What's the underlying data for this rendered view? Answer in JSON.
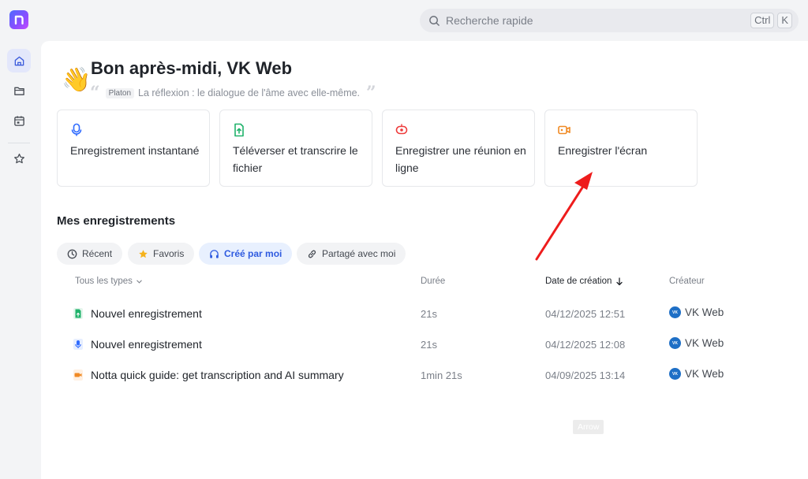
{
  "app": {
    "logo_letter": "n"
  },
  "search": {
    "placeholder": "Recherche rapide",
    "shortcut_keys": [
      "Ctrl",
      "K"
    ]
  },
  "sidebar": {
    "items": [
      {
        "icon": "home-icon",
        "active": true
      },
      {
        "icon": "folder-icon",
        "active": false
      },
      {
        "icon": "calendar-icon",
        "active": false
      },
      {
        "icon": "star-icon",
        "active": false
      }
    ]
  },
  "greeting": {
    "emoji": "👋",
    "title": "Bon après-midi, VK Web",
    "quote_author": "Platon",
    "quote_text": "La réflexion : le dialogue de l'âme avec elle-même."
  },
  "actions": [
    {
      "icon": "microphone-icon",
      "color": "#2f6bff",
      "label": "Enregistrement instantané"
    },
    {
      "icon": "upload-file-icon",
      "color": "#20b26b",
      "label": "Téléverser et transcrire le fichier"
    },
    {
      "icon": "meeting-icon",
      "color": "#ee3b3b",
      "label": "Enregistrer une réunion en ligne"
    },
    {
      "icon": "video-camera-icon",
      "color": "#f08a24",
      "label": "Enregistrer l'écran"
    }
  ],
  "recordings": {
    "title": "Mes enregistrements",
    "filters": [
      {
        "icon": "clock-icon",
        "label": "Récent",
        "active": false
      },
      {
        "icon": "star-filled-icon",
        "label": "Favoris",
        "active": false
      },
      {
        "icon": "headphones-icon",
        "label": "Créé par moi",
        "active": true
      },
      {
        "icon": "link-icon",
        "label": "Partagé avec moi",
        "active": false
      }
    ],
    "columns": {
      "type": "Tous les types",
      "duration": "Durée",
      "date": "Date de création",
      "creator": "Créateur"
    },
    "rows": [
      {
        "type_icon": "upload-file-icon",
        "type_color": "#20b26b",
        "name": "Nouvel enregistrement",
        "duration": "21s",
        "date": "04/12/2025 12:51",
        "creator": "VK Web"
      },
      {
        "type_icon": "microphone-icon",
        "type_color": "#2f6bff",
        "name": "Nouvel enregistrement",
        "duration": "21s",
        "date": "04/12/2025 12:08",
        "creator": "VK Web"
      },
      {
        "type_icon": "video-camera-icon",
        "type_color": "#f08a24",
        "name": "Notta quick guide: get transcription and AI summary",
        "duration": "1min 21s",
        "date": "04/09/2025 13:14",
        "creator": "VK Web"
      }
    ]
  },
  "tooltip": {
    "text": "Arrow"
  },
  "annotation": {
    "color": "#ee1c1c"
  }
}
